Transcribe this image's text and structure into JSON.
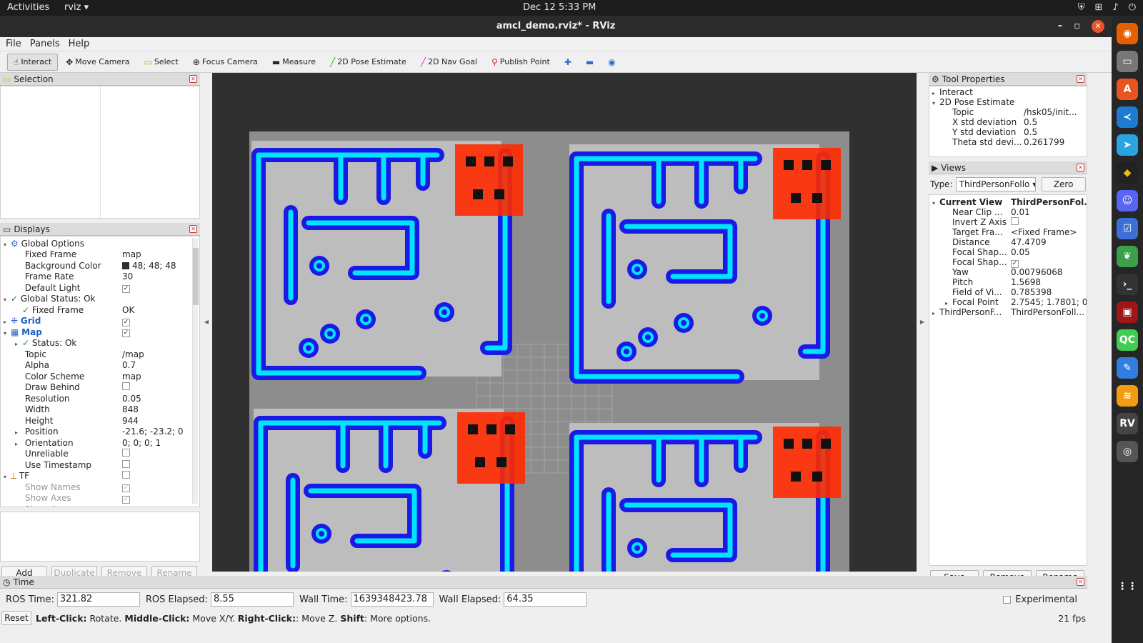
{
  "topbar": {
    "activities": "Activities",
    "app": "rviz ▾",
    "clock": "Dec 12  5:33 PM"
  },
  "window": {
    "title": "amcl_demo.rviz* - RViz"
  },
  "menu": [
    "File",
    "Panels",
    "Help"
  ],
  "toolbar": {
    "interact": "Interact",
    "move_camera": "Move Camera",
    "select": "Select",
    "focus_camera": "Focus Camera",
    "measure": "Measure",
    "pose_estimate": "2D Pose Estimate",
    "nav_goal": "2D Nav Goal",
    "publish_point": "Publish Point"
  },
  "selection": {
    "title": "Selection"
  },
  "displays": {
    "title": "Displays",
    "rows": [
      {
        "k": "Global Options",
        "v": ""
      },
      {
        "k": "Fixed Frame",
        "v": "map"
      },
      {
        "k": "Background Color",
        "v": "48; 48; 48"
      },
      {
        "k": "Frame Rate",
        "v": "30"
      },
      {
        "k": "Default Light",
        "v": "✓"
      },
      {
        "k": "Global Status: Ok",
        "v": ""
      },
      {
        "k": "Fixed Frame",
        "v": "OK"
      },
      {
        "k": "Grid",
        "v": "✓"
      },
      {
        "k": "Map",
        "v": "✓"
      },
      {
        "k": "Status: Ok",
        "v": ""
      },
      {
        "k": "Topic",
        "v": "/map"
      },
      {
        "k": "Alpha",
        "v": "0.7"
      },
      {
        "k": "Color Scheme",
        "v": "map"
      },
      {
        "k": "Draw Behind",
        "v": ""
      },
      {
        "k": "Resolution",
        "v": "0.05"
      },
      {
        "k": "Width",
        "v": "848"
      },
      {
        "k": "Height",
        "v": "944"
      },
      {
        "k": "Position",
        "v": "-21.6; -23.2; 0"
      },
      {
        "k": "Orientation",
        "v": "0; 0; 0; 1"
      },
      {
        "k": "Unreliable",
        "v": ""
      },
      {
        "k": "Use Timestamp",
        "v": ""
      },
      {
        "k": "TF",
        "v": ""
      },
      {
        "k": "Show Names",
        "v": "✓"
      },
      {
        "k": "Show Axes",
        "v": "✓"
      },
      {
        "k": "Show Arrows",
        "v": "✓"
      }
    ],
    "buttons": {
      "add": "Add",
      "duplicate": "Duplicate",
      "remove": "Remove",
      "rename": "Rename"
    }
  },
  "tool_properties": {
    "title": "Tool Properties",
    "rows": [
      {
        "k": "Interact",
        "v": ""
      },
      {
        "k": "2D Pose Estimate",
        "v": ""
      },
      {
        "k": "Topic",
        "v": "/hsk05/init..."
      },
      {
        "k": "X std deviation",
        "v": "0.5"
      },
      {
        "k": "Y std deviation",
        "v": "0.5"
      },
      {
        "k": "Theta std devi...",
        "v": "0.261799"
      }
    ]
  },
  "views": {
    "title": "Views",
    "type_label": "Type:",
    "type_value": "ThirdPersonFollo",
    "zero": "Zero",
    "rows": [
      {
        "k": "Current View",
        "v": "ThirdPersonFol..."
      },
      {
        "k": "Near Clip ...",
        "v": "0.01"
      },
      {
        "k": "Invert Z Axis",
        "v": ""
      },
      {
        "k": "Target Fra...",
        "v": "<Fixed Frame>"
      },
      {
        "k": "Distance",
        "v": "47.4709"
      },
      {
        "k": "Focal Shap...",
        "v": "0.05"
      },
      {
        "k": "Focal Shap...",
        "v": "✓"
      },
      {
        "k": "Yaw",
        "v": "0.00796068"
      },
      {
        "k": "Pitch",
        "v": "1.5698"
      },
      {
        "k": "Field of Vi...",
        "v": "0.785398"
      },
      {
        "k": "Focal Point",
        "v": "2.7545; 1.7801; 0"
      },
      {
        "k": "ThirdPersonF...",
        "v": "ThirdPersonFoll..."
      }
    ],
    "buttons": {
      "save": "Save",
      "remove": "Remove",
      "rename": "Rename"
    }
  },
  "time": {
    "title": "Time",
    "ros_time_label": "ROS Time:",
    "ros_time": "321.82",
    "ros_elapsed_label": "ROS Elapsed:",
    "ros_elapsed": "8.55",
    "wall_time_label": "Wall Time:",
    "wall_time": "1639348423.78",
    "wall_elapsed_label": "Wall Elapsed:",
    "wall_elapsed": "64.35",
    "experimental": "Experimental"
  },
  "status": {
    "reset": "Reset",
    "lc": "Left-Click:",
    "lc_t": " Rotate. ",
    "mc": "Middle-Click:",
    "mc_t": " Move X/Y. ",
    "rc": "Right-Click:",
    "rc_t": ": Move Z. ",
    "sh": "Shift",
    "sh_t": ": More options.",
    "fps": "21 fps"
  },
  "colors": {
    "background": "#303030",
    "map_free": "#bdbdbd",
    "inflation": "#1a1ae6",
    "obstacle": "#00e5ff",
    "particles": "#ff2a00"
  }
}
